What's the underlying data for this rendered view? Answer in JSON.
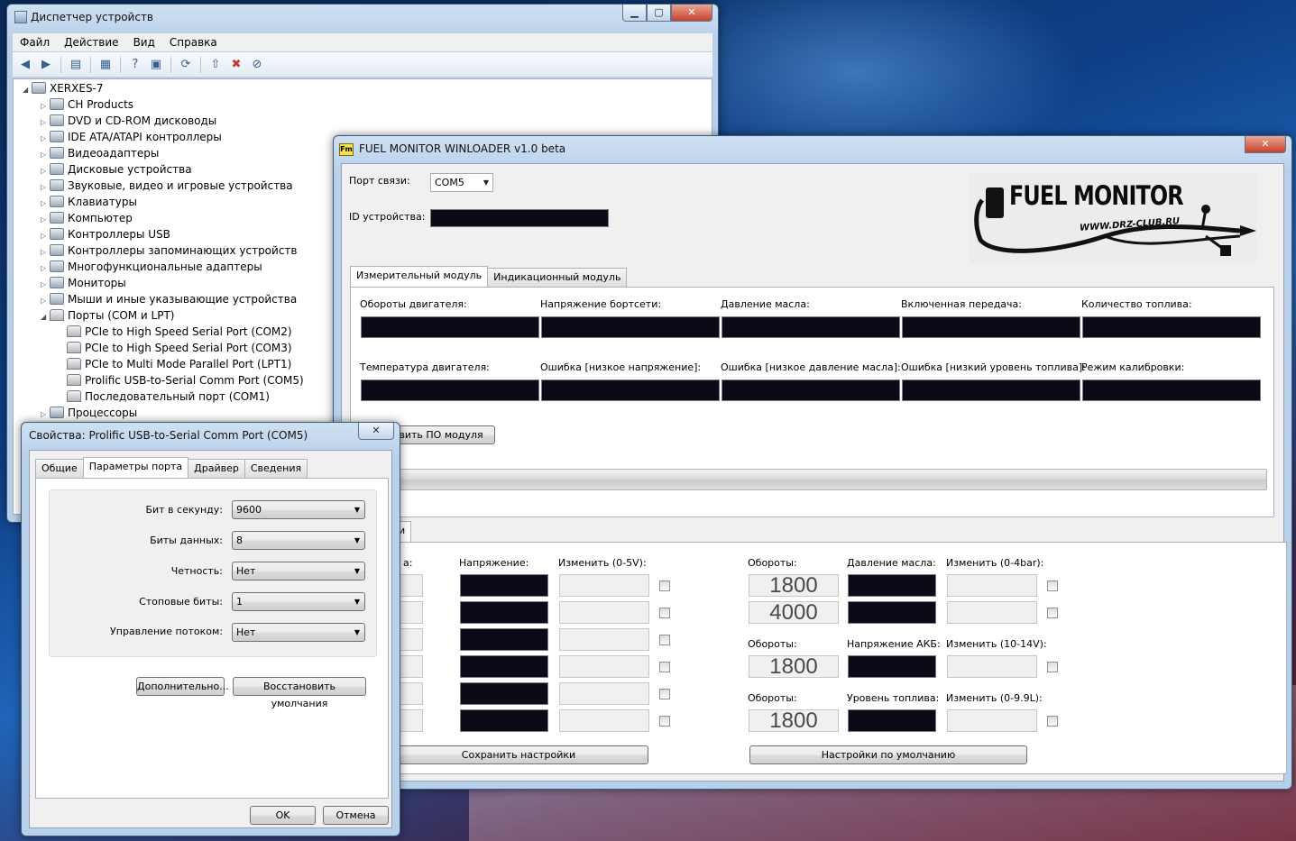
{
  "devmgr": {
    "title": "Диспетчер устройств",
    "caption": {
      "min": "▁",
      "max": "▢",
      "close": "✕"
    },
    "menu": [
      "Файл",
      "Действие",
      "Вид",
      "Справка"
    ],
    "toolbar_icons": [
      "back-icon",
      "forward-icon",
      "properties-icon",
      "show-hidden-icon",
      "help-icon",
      "view-icon",
      "scan-icon",
      "update-driver-icon",
      "uninstall-icon",
      "disable-icon"
    ],
    "tree": [
      {
        "label": "XERXES-7",
        "expander": "◢"
      },
      {
        "label": "CH Products",
        "expander": "▷"
      },
      {
        "label": "DVD и CD-ROM дисководы",
        "expander": "▷"
      },
      {
        "label": "IDE ATA/ATAPI контроллеры",
        "expander": "▷"
      },
      {
        "label": "Видеоадаптеры",
        "expander": "▷"
      },
      {
        "label": "Дисковые устройства",
        "expander": "▷"
      },
      {
        "label": "Звуковые, видео и игровые устройства",
        "expander": "▷"
      },
      {
        "label": "Клавиатуры",
        "expander": "▷"
      },
      {
        "label": "Компьютер",
        "expander": "▷"
      },
      {
        "label": "Контроллеры USB",
        "expander": "▷"
      },
      {
        "label": "Контроллеры запоминающих устройств",
        "expander": "▷"
      },
      {
        "label": "Многофункциональные адаптеры",
        "expander": "▷"
      },
      {
        "label": "Мониторы",
        "expander": "▷"
      },
      {
        "label": "Мыши и иные указывающие устройства",
        "expander": "▷"
      },
      {
        "label": "Порты (COM и LPT)",
        "expander": "◢"
      },
      {
        "label": "PCIe to High Speed Serial Port (COM2)",
        "expander": ""
      },
      {
        "label": "PCIe to High Speed Serial Port (COM3)",
        "expander": ""
      },
      {
        "label": "PCIe to Multi Mode Parallel Port (LPT1)",
        "expander": ""
      },
      {
        "label": "Prolific USB-to-Serial Comm Port (COM5)",
        "expander": ""
      },
      {
        "label": "Последовательный порт (COM1)",
        "expander": ""
      },
      {
        "label": "Процессоры",
        "expander": "▷"
      }
    ]
  },
  "fuel": {
    "title": "FUEL MONITOR WINLOADER v1.0 beta",
    "icon_text": "Fm",
    "close": "✕",
    "port_label": "Порт связи:",
    "port_value": "COM5",
    "device_id_label": "ID устройства:",
    "logo": {
      "title": "FUEL MONITOR",
      "subtitle": "WWW.DRZ-CLUB.RU"
    },
    "tabs": [
      "Измерительный модуль",
      "Индикационный модуль"
    ],
    "meas_labels_row1": [
      "Обороты двигателя:",
      "Напряжение бортсети:",
      "Давление масла:",
      "Включенная передача:",
      "Количество топлива:"
    ],
    "meas_labels_row2": [
      "Температура двигателя:",
      "Ошибка [низкое напряжение]:",
      "Ошибка [низкое давление масла]:",
      "Ошибка [низкий уровень топлива]:",
      "Режим калибровки:"
    ],
    "update_button": "вить ПО модуля",
    "lower_tab_fragment": "и",
    "left_group": {
      "col_fragment_label": "а:",
      "voltage_label": "Напряжение:",
      "change_label": "Изменить (0-5V):"
    },
    "right_group": {
      "rpm_label": "Обороты:",
      "oil_label": "Давление масла:",
      "change_oil": "Изменить (0-4bar):",
      "rpm_values": [
        "1800",
        "4000"
      ],
      "rpm2_label": "Обороты:",
      "batt_label": "Напряжение АКБ:",
      "change_batt": "Изменить (10-14V):",
      "rpm2_value": "1800",
      "rpm3_label": "Обороты:",
      "fuel_label": "Уровень топлива:",
      "change_fuel": "Изменить (0-9.9L):",
      "rpm3_value": "1800"
    },
    "save_button": "Сохранить настройки",
    "defaults_button": "Настройки по умолчанию"
  },
  "props": {
    "title": "Свойства: Prolific USB-to-Serial Comm Port (COM5)",
    "close": "✕",
    "tabs": [
      "Общие",
      "Параметры порта",
      "Драйвер",
      "Сведения"
    ],
    "fields": [
      {
        "label": "Бит в секунду:",
        "value": "9600"
      },
      {
        "label": "Биты данных:",
        "value": "8"
      },
      {
        "label": "Четность:",
        "value": "Нет"
      },
      {
        "label": "Стоповые биты:",
        "value": "1"
      },
      {
        "label": "Управление потоком:",
        "value": "Нет"
      }
    ],
    "advanced_button": "Дополнительно...",
    "restore_button": "Восстановить умолчания",
    "ok_button": "OK",
    "cancel_button": "Отмена"
  }
}
